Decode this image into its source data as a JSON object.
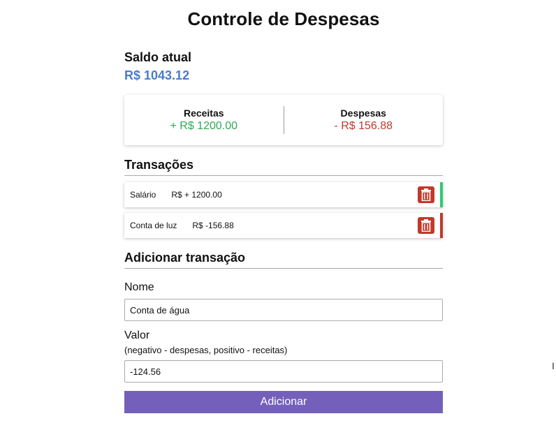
{
  "header": {
    "title": "Controle de Despesas"
  },
  "balance": {
    "label": "Saldo atual",
    "value": "R$ 1043.12"
  },
  "summary": {
    "income_label": "Receitas",
    "income_value": "+ R$ 1200.00",
    "expense_label": "Despesas",
    "expense_value": "- R$ 156.88",
    "colors": {
      "income": "#2eaa55",
      "expense": "#c0392b"
    }
  },
  "transactions": {
    "heading": "Transações",
    "items": [
      {
        "name": "Salário",
        "amount": "R$ + 1200.00",
        "type": "income",
        "delete_icon": "trash-icon"
      },
      {
        "name": "Conta de luz",
        "amount": "R$ -156.88",
        "type": "expense",
        "delete_icon": "trash-icon"
      }
    ]
  },
  "form": {
    "heading": "Adicionar transação",
    "name_label": "Nome",
    "name_value": "Conta de água",
    "value_label": "Valor",
    "value_hint": "(negativo - despesas, positivo - receitas)",
    "value_value": "-124.56",
    "submit_label": "Adicionar",
    "accent": "#7460bb"
  }
}
